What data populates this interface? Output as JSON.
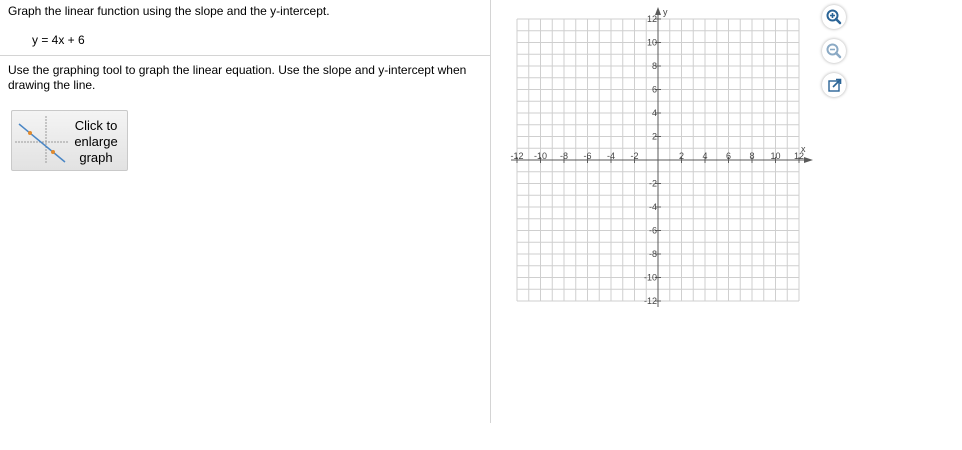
{
  "question": {
    "title": "Graph the linear function using the slope and the y-intercept.",
    "equation": "y = 4x + 6",
    "instructions": "Use the graphing tool to graph the linear equation. Use the slope and y-intercept when drawing the line.",
    "enlarge_button_label": "Click to enlarge graph"
  },
  "graph": {
    "x_axis_label": "x",
    "y_axis_label": "y",
    "x_range": [
      -12,
      12
    ],
    "y_range": [
      -12,
      12
    ],
    "grid_step": 1,
    "x_tick_labels": [
      "-12",
      "-10",
      "-8",
      "-6",
      "-4",
      "-2",
      "2",
      "4",
      "6",
      "8",
      "10",
      "12"
    ],
    "y_tick_labels": [
      "12",
      "10",
      "8",
      "6",
      "4",
      "2",
      "-2",
      "-4",
      "-6",
      "-8",
      "-10",
      "-12"
    ]
  },
  "toolbar": {
    "zoom_in_icon": "zoom-in-icon",
    "zoom_out_icon": "zoom-out-icon",
    "popout_icon": "popout-icon",
    "accent_color": "#2a6496"
  },
  "colors": {
    "grid": "#cfcfcf",
    "axis": "#5a5a5a",
    "divider": "#d4d4d4"
  }
}
